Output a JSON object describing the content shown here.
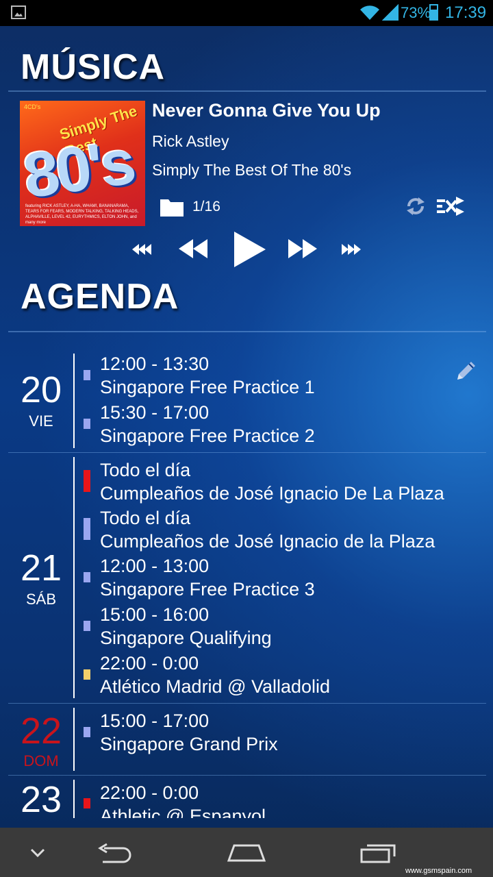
{
  "status_bar": {
    "battery": "73%",
    "time": "17:39"
  },
  "music": {
    "section_title": "MÚSICA",
    "album_art": {
      "cds_label": "4CD's",
      "title_art": "Simply The Best",
      "big_text": "80's",
      "fine_print": "featuring RICK ASTLEY, A-HA, WHAM!, BANANARAMA, TEARS FOR FEARS, MODERN TALKING, TALKING HEADS, ALPHAVILLE, LEVEL 42, EURYTHMICS, ELTON JOHN, and many more"
    },
    "track_title": "Never Gonna Give You Up",
    "artist": "Rick Astley",
    "album": "Simply The Best Of The 80's",
    "track_position": "1/16"
  },
  "agenda": {
    "section_title": "AGENDA",
    "days": [
      {
        "num": "20",
        "name": "VIE",
        "events": [
          {
            "time": "12:00 - 13:30",
            "title": "Singapore Free Practice 1",
            "color": "#9aa6f0"
          },
          {
            "time": "15:30 - 17:00",
            "title": "Singapore Free Practice 2",
            "color": "#9aa6f0"
          }
        ]
      },
      {
        "num": "21",
        "name": "SÁB",
        "events": [
          {
            "time": "Todo el día",
            "title": "Cumpleaños de José Ignacio De La Plaza",
            "color": "#e8151a"
          },
          {
            "time": "Todo el día",
            "title": "Cumpleaños de José Ignacio de la Plaza",
            "color": "#9aa6f0"
          },
          {
            "time": "12:00 - 13:00",
            "title": "Singapore Free Practice 3",
            "color": "#9aa6f0"
          },
          {
            "time": "15:00 - 16:00",
            "title": "Singapore Qualifying",
            "color": "#9aa6f0"
          },
          {
            "time": "22:00 - 0:00",
            "title": "Atlético Madrid @ Valladolid",
            "color": "#f3cf6a"
          }
        ]
      },
      {
        "num": "22",
        "name": "DOM",
        "highlight_color": "#c8141c",
        "events": [
          {
            "time": "15:00 - 17:00",
            "title": "Singapore Grand Prix",
            "color": "#9aa6f0"
          }
        ]
      },
      {
        "num": "23",
        "name": "",
        "events": [
          {
            "time": "22:00 - 0:00",
            "title": "Athletic @ Espanyol",
            "color": "#e8151a"
          }
        ]
      }
    ]
  },
  "watermark": "www.gsmspain.com",
  "icons": [
    "gallery-icon",
    "wifi-icon",
    "signal-icon",
    "battery-icon",
    "folder-icon",
    "repeat-icon",
    "shuffle-icon",
    "skip-previous-icon",
    "rewind-icon",
    "play-icon",
    "fast-forward-icon",
    "skip-next-icon",
    "pencil-icon",
    "chevron-down-icon",
    "back-icon",
    "home-icon",
    "recents-icon"
  ]
}
